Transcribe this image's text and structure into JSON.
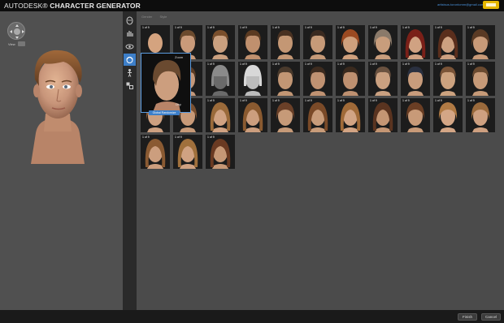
{
  "app": {
    "brand_primary": "AUTODESK",
    "brand_secondary": "CHARACTER GENERATOR",
    "user_email": "artistsus.torontomm@gmail.com"
  },
  "viewport": {
    "view_label": "View"
  },
  "toolstrip": {
    "tools": [
      "head-shape-icon",
      "hand-icon",
      "eye-icon",
      "hair-icon",
      "body-icon",
      "clothing-icon"
    ],
    "active_index": 3
  },
  "gallery": {
    "filters": [
      "Gender",
      "Style"
    ],
    "thumb_badge": "1 of 9",
    "thumbs": [
      {
        "hair": "bald",
        "color": "#c79a78",
        "skin": "#d4a37f"
      },
      {
        "hair": "short",
        "color": "#6b4a2e",
        "skin": "#c99a7a"
      },
      {
        "hair": "short",
        "color": "#7a4f2c",
        "skin": "#caa07f"
      },
      {
        "hair": "short",
        "color": "#5c3b22",
        "skin": "#c0906e"
      },
      {
        "hair": "short",
        "color": "#4a3222",
        "skin": "#c49774"
      },
      {
        "hair": "short",
        "color": "#3a2a20",
        "skin": "#c69a78"
      },
      {
        "hair": "medium",
        "color": "#9b4a22",
        "skin": "#cfa07d"
      },
      {
        "hair": "medium",
        "color": "#8a7a6a",
        "skin": "#c89d7c"
      },
      {
        "hair": "long",
        "color": "#7a2018",
        "skin": "#d0a282"
      },
      {
        "hair": "long",
        "color": "#5a2e1c",
        "skin": "#cda080"
      },
      {
        "hair": "medium",
        "color": "#5a3a24",
        "skin": "#c89a78"
      },
      {
        "hair": "short",
        "color": "#6e4a2e",
        "skin": "#cca07e"
      },
      {
        "hair": "short",
        "color": "#5c3c24",
        "skin": "#c4987a"
      },
      {
        "hair": "helmet",
        "color": "#8a8a8a",
        "skin": "#6a6a6a"
      },
      {
        "hair": "helmet",
        "color": "#d8d8d8",
        "skin": "#bcbcbc"
      },
      {
        "hair": "short",
        "color": "#4a3a2c",
        "skin": "#c29674"
      },
      {
        "hair": "short",
        "color": "#3e2c20",
        "skin": "#c09272"
      },
      {
        "hair": "short",
        "color": "#3a2a1e",
        "skin": "#be9070"
      },
      {
        "hair": "short",
        "color": "#6a5240",
        "skin": "#caa080"
      },
      {
        "hair": "short",
        "color": "#2a3040",
        "skin": "#c89c7c"
      },
      {
        "hair": "short",
        "color": "#7a5438",
        "skin": "#cca27f"
      },
      {
        "hair": "short",
        "color": "#6a4a30",
        "skin": "#c69a78"
      },
      {
        "hair": "medium",
        "color": "#8a5a34",
        "skin": "#cda080"
      },
      {
        "hair": "medium",
        "color": "#7a5030",
        "skin": "#c89a78"
      },
      {
        "hair": "long",
        "color": "#9a6a3a",
        "skin": "#d0a282"
      },
      {
        "hair": "long",
        "color": "#8a5a30",
        "skin": "#cc9e7e"
      },
      {
        "hair": "medium",
        "color": "#6a4028",
        "skin": "#c69a78"
      },
      {
        "hair": "long",
        "color": "#7a4a28",
        "skin": "#c89c7a"
      },
      {
        "hair": "long",
        "color": "#a06a38",
        "skin": "#d2a484"
      },
      {
        "hair": "long",
        "color": "#5a3420",
        "skin": "#c49674"
      },
      {
        "hair": "medium",
        "color": "#6a3e24",
        "skin": "#c89a78"
      },
      {
        "hair": "medium",
        "color": "#b07a44",
        "skin": "#d4a686"
      },
      {
        "hair": "medium",
        "color": "#9a6a3c",
        "skin": "#cea080"
      },
      {
        "hair": "long",
        "color": "#8a5a32",
        "skin": "#cc9e7e"
      },
      {
        "hair": "long",
        "color": "#a0703c",
        "skin": "#d0a282"
      },
      {
        "hair": "long",
        "color": "#6a3a22",
        "skin": "#c69876"
      }
    ],
    "zoom": {
      "label": "Zoom",
      "select_label": "Disp",
      "button_label": "Global Randomize"
    }
  },
  "footer": {
    "finish_label": "Finish",
    "cancel_label": "Cancel"
  },
  "colors": {
    "accent": "#3d7fc9",
    "help": "#e6b800"
  }
}
